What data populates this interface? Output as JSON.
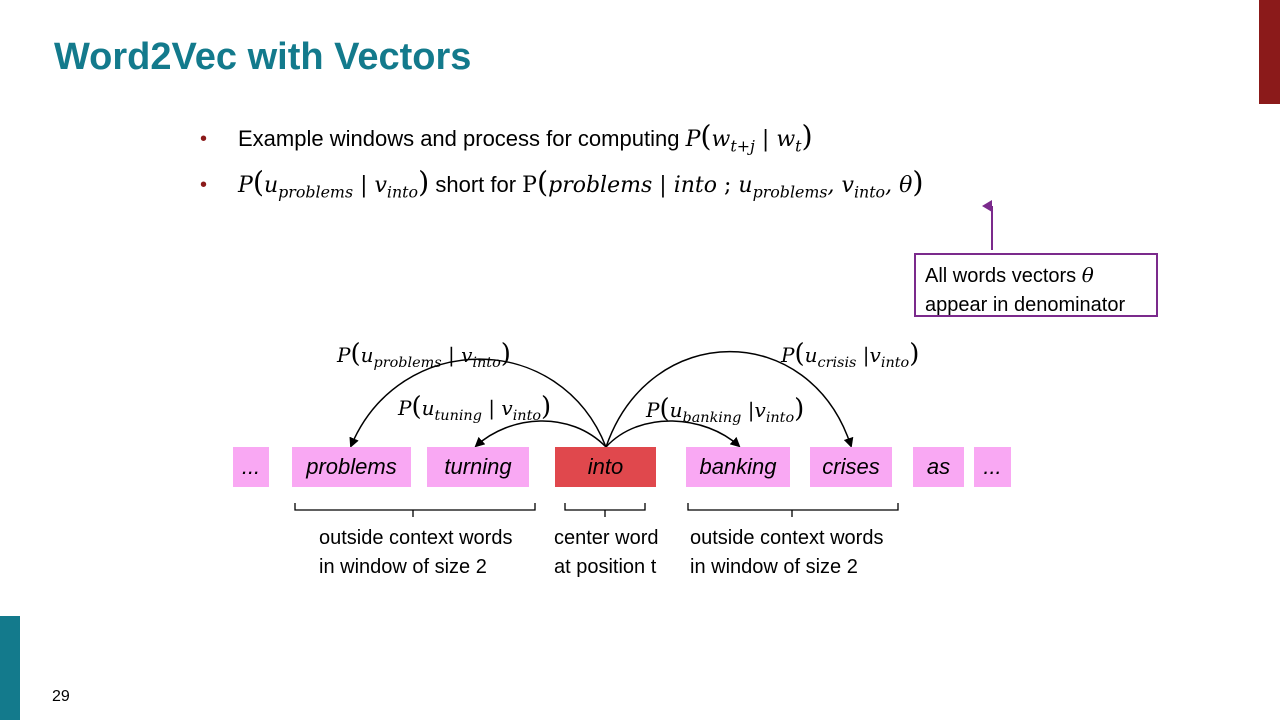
{
  "title": "Word2Vec with Vectors",
  "page_number": "29",
  "bullets": [
    {
      "text": "Example windows and process for computing ",
      "math": {
        "P": "P",
        "w1": "w",
        "s1": "t+j",
        "bar": "|",
        "w2": "w",
        "s2": "t"
      }
    },
    {
      "lhs": {
        "P": "P",
        "u": "u",
        "us": "problems",
        "bar": "|",
        "v": "v",
        "vs": "into"
      },
      "text": " short for ",
      "rhs": {
        "P": "P",
        "arg1": "problems",
        "bar": "|",
        "arg2": "into",
        "semi": ";",
        "u": "u",
        "us": "problems",
        "v": "v",
        "vs": "into",
        "theta": "θ"
      }
    }
  ],
  "callout": {
    "line1": "All words vectors ",
    "theta": "θ",
    "line2": "appear in denominator"
  },
  "words": [
    "...",
    "problems",
    "turning",
    "into",
    "banking",
    "crises",
    "as",
    "..."
  ],
  "prob_labels": [
    {
      "P": "P",
      "u": "u",
      "us": "problems",
      "bar": "|",
      "v": "v",
      "vs": "into"
    },
    {
      "P": "P",
      "u": "u",
      "us": "tuning",
      "bar": "|",
      "v": "v",
      "vs": "into"
    },
    {
      "P": "P",
      "u": "u",
      "us": "banking",
      "bar": "|",
      "v": "v",
      "vs": "into"
    },
    {
      "P": "P",
      "u": "u",
      "us": "crisis",
      "bar": "|",
      "v": "v",
      "vs": "into"
    }
  ],
  "captions": {
    "left": [
      "outside context words",
      "in window of size 2"
    ],
    "center": [
      "center word",
      "at position t"
    ],
    "right": [
      "outside context words",
      "in window of size 2"
    ]
  },
  "colors": {
    "title": "#137a8c",
    "accent_red": "#8b1a1a",
    "context_box": "#f9a8f3",
    "center_box": "#e0484d",
    "callout_border": "#7b2a8c"
  }
}
